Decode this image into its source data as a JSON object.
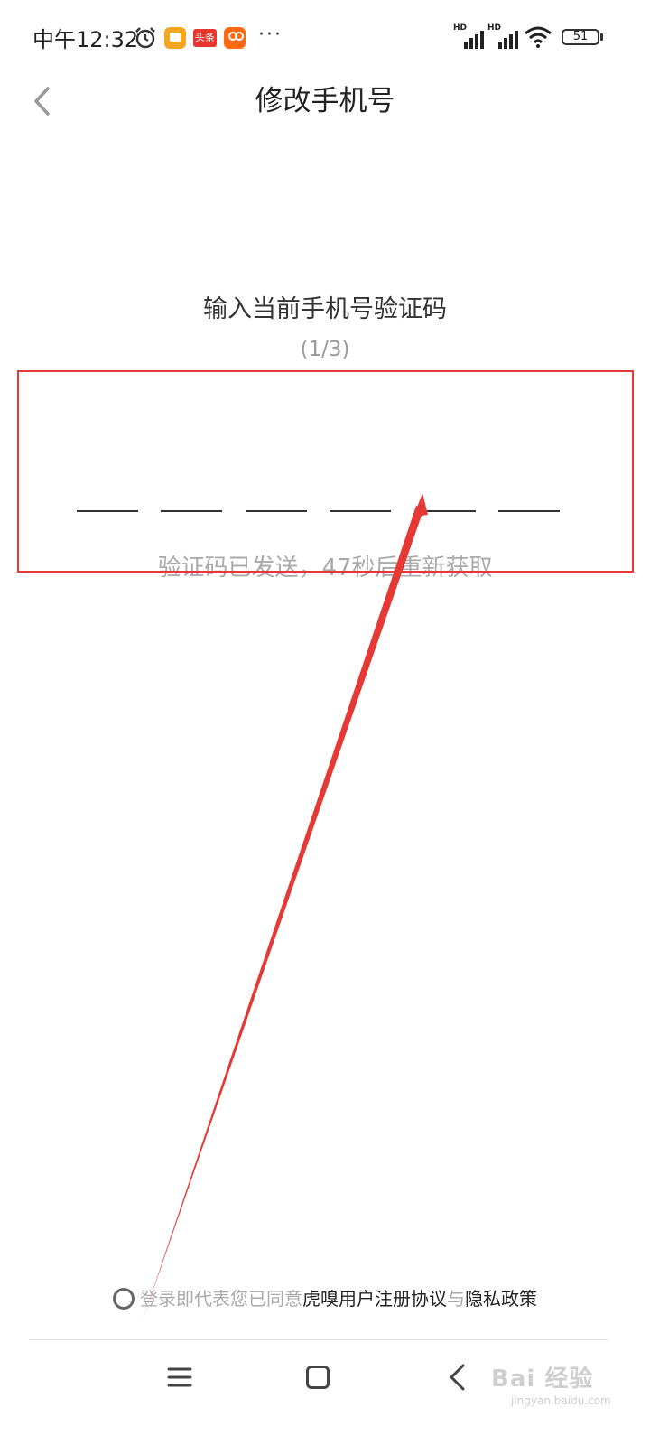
{
  "status_bar": {
    "time": "中午12:32",
    "toutiao_label": "头条",
    "more": "···",
    "signal_label": "HD",
    "battery": "51"
  },
  "header": {
    "title": "修改手机号",
    "back_icon": "chevron-left-icon"
  },
  "verify": {
    "prompt": "输入当前手机号验证码",
    "step": "(1/3)",
    "code_length": 6,
    "resend_text": "验证码已发送，47秒后重新获取"
  },
  "agreement": {
    "prefix": "登录即代表您已同意",
    "terms_link": "虎嗅用户注册协议",
    "conjunction": "与",
    "privacy_link": "隐私政策"
  },
  "nav_bar": {
    "menu_icon": "menu-icon",
    "home_icon": "home-square-icon",
    "back_icon": "back-chevron-icon"
  },
  "watermark": {
    "text": "Bai 经验",
    "sub": "jingyan.baidu.com"
  },
  "colors": {
    "annotation": "#e53935",
    "hint_gray": "#aaaaaa",
    "text": "#222222"
  }
}
